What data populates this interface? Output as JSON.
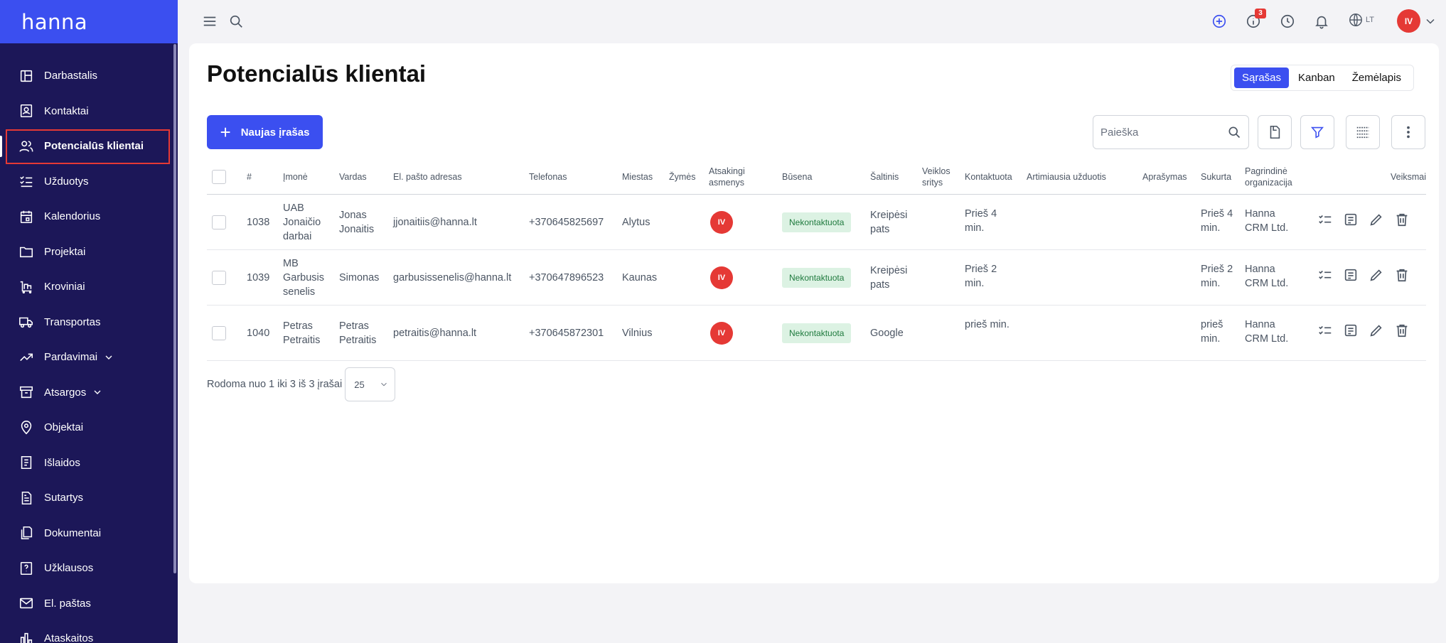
{
  "app": {
    "brand": "hanna"
  },
  "sidebar": {
    "items": [
      {
        "label": "Darbastalis",
        "icon": "dashboard-icon"
      },
      {
        "label": "Kontaktai",
        "icon": "contact-card-icon"
      },
      {
        "label": "Potencialūs klientai",
        "icon": "users-icon",
        "active": true
      },
      {
        "label": "Užduotys",
        "icon": "checklist-icon"
      },
      {
        "label": "Kalendorius",
        "icon": "calendar-icon"
      },
      {
        "label": "Projektai",
        "icon": "folder-icon"
      },
      {
        "label": "Kroviniai",
        "icon": "cart-icon"
      },
      {
        "label": "Transportas",
        "icon": "truck-icon"
      },
      {
        "label": "Pardavimai",
        "icon": "trend-icon",
        "expandable": true
      },
      {
        "label": "Atsargos",
        "icon": "archive-icon",
        "expandable": true
      },
      {
        "label": "Objektai",
        "icon": "location-pin-icon"
      },
      {
        "label": "Išlaidos",
        "icon": "receipt-icon"
      },
      {
        "label": "Sutartys",
        "icon": "document-icon"
      },
      {
        "label": "Dokumentai",
        "icon": "documents-icon"
      },
      {
        "label": "Užklausos",
        "icon": "question-icon"
      },
      {
        "label": "El. paštas",
        "icon": "mail-icon"
      },
      {
        "label": "Ataskaitos",
        "icon": "bar-chart-icon"
      }
    ]
  },
  "topbar": {
    "notifications_badge": "3",
    "language": "LT",
    "user_initials": "IV"
  },
  "page": {
    "title": "Potencialūs klientai",
    "views": [
      {
        "label": "Sąrašas",
        "active": true
      },
      {
        "label": "Kanban",
        "active": false
      },
      {
        "label": "Žemėlapis",
        "active": false
      }
    ],
    "new_button": "Naujas įrašas",
    "search_placeholder": "Paieška"
  },
  "table": {
    "columns": {
      "id": "#",
      "company": "Įmonė",
      "name": "Vardas",
      "email": "El. pašto adresas",
      "phone": "Telefonas",
      "city": "Miestas",
      "tags": "Žymės",
      "responsible": "Atsakingi asmenys",
      "status": "Būsena",
      "source": "Šaltinis",
      "activity": "Veiklos sritys",
      "contacted": "Kontaktuota",
      "next_task": "Artimiausia užduotis",
      "description": "Aprašymas",
      "created": "Sukurta",
      "org": "Pagrindinė organizacija",
      "actions": "Veiksmai"
    },
    "rows": [
      {
        "id": "1038",
        "company": "UAB Jonaičio darbai",
        "name": "Jonas Jonaitis",
        "email": "jjonaitiis@hanna.lt",
        "phone": "+370645825697",
        "city": "Alytus",
        "responsible": "IV",
        "status": "Nekontaktuota",
        "source": "Kreipėsi pats",
        "contacted": "Prieš 4 min.",
        "created": "Prieš 4 min.",
        "org": "Hanna CRM Ltd."
      },
      {
        "id": "1039",
        "company": "MB Garbusis senelis",
        "name": "Simonas",
        "email": "garbusissenelis@hanna.lt",
        "phone": "+370647896523",
        "city": "Kaunas",
        "responsible": "IV",
        "status": "Nekontaktuota",
        "source": "Kreipėsi pats",
        "contacted": "Prieš 2 min.",
        "created": "Prieš 2 min.",
        "org": "Hanna CRM Ltd."
      },
      {
        "id": "1040",
        "company": "Petras Petraitis",
        "name": "Petras Petraitis",
        "email": "petraitis@hanna.lt",
        "phone": "+370645872301",
        "city": "Vilnius",
        "responsible": "IV",
        "status": "Nekontaktuota",
        "source": "Google",
        "contacted": "prieš min.",
        "created": "prieš min.",
        "org": "Hanna CRM Ltd."
      }
    ]
  },
  "pagination": {
    "summary": "Rodoma nuo 1 iki 3 iš 3 įrašai",
    "per_page": "25"
  },
  "colors": {
    "sidebar_bg": "#1c1758",
    "accent": "#3b4ff0",
    "status_bg": "#dcf2e3",
    "avatar": "#e53935"
  }
}
